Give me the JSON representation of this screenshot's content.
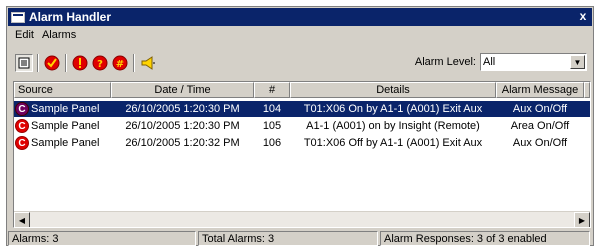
{
  "window": {
    "title": "Alarm Handler",
    "close_label": "x"
  },
  "menu": {
    "items": [
      "Edit",
      "Alarms"
    ]
  },
  "toolbar": {
    "alarm_level_label": "Alarm Level:",
    "alarm_level_value": "All",
    "buttons": [
      "list-view-icon",
      "acknowledge-icon",
      "alarm-exclamation-icon",
      "alarm-query-icon",
      "alarm-hash-icon",
      "horn-icon"
    ]
  },
  "table": {
    "columns": [
      "Source",
      "Date / Time",
      "#",
      "Details",
      "Alarm Message"
    ],
    "rows": [
      {
        "source": "Sample Panel",
        "datetime": "26/10/2005 1:20:30 PM",
        "num": "104",
        "details": "T01:X06 On by A1-1 (A001) Exit Aux",
        "message": "Aux On/Off",
        "selected": true
      },
      {
        "source": "Sample Panel",
        "datetime": "26/10/2005 1:20:30 PM",
        "num": "105",
        "details": "A1-1 (A001) on by Insight (Remote)",
        "message": "Area On/Off",
        "selected": false
      },
      {
        "source": "Sample Panel",
        "datetime": "26/10/2005 1:20:32 PM",
        "num": "106",
        "details": "T01:X06 Off by A1-1 (A001) Exit Aux",
        "message": "Aux On/Off",
        "selected": false
      }
    ],
    "row_icon_letter": "C"
  },
  "status": {
    "alarms": "Alarms: 3",
    "total": "Total Alarms: 3",
    "responses": "Alarm Responses: 3 of 3 enabled"
  },
  "colors": {
    "title_bar": "#0a246a",
    "selection": "#0a246a",
    "alarm_red": "#e00000",
    "face": "#d4d0c8"
  }
}
